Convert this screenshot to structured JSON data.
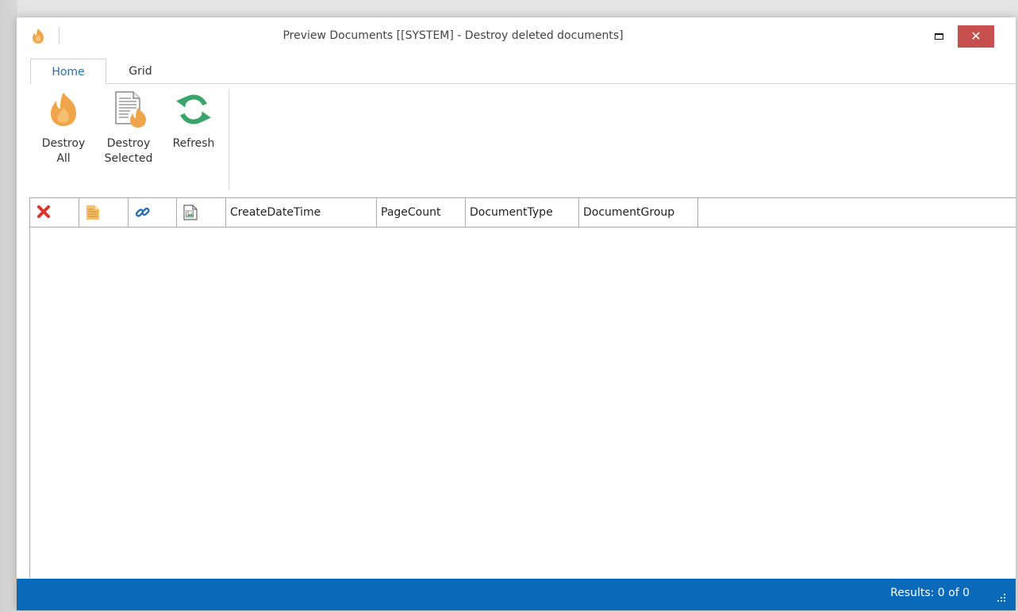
{
  "window": {
    "title": "Preview Documents [[SYSTEM] - Destroy deleted documents]",
    "close_glyph": "✕",
    "app_icon": "flame-icon"
  },
  "tabs": [
    {
      "label": "Home",
      "active": true
    },
    {
      "label": "Grid",
      "active": false
    }
  ],
  "ribbon": {
    "buttons": [
      {
        "label": "Destroy\nAll",
        "icon": "flame-icon"
      },
      {
        "label": "Destroy\nSelected",
        "icon": "document-flame-icon"
      },
      {
        "label": "Refresh",
        "icon": "refresh-icon"
      }
    ]
  },
  "grid": {
    "icon_columns": [
      "delete-icon",
      "document-icon",
      "link-icon",
      "image-document-icon"
    ],
    "columns": [
      "CreateDateTime",
      "PageCount",
      "DocumentType",
      "DocumentGroup"
    ],
    "rows": []
  },
  "status": {
    "results": "Results: 0 of 0"
  },
  "colors": {
    "accent": "#0a69b8",
    "close_button": "#c7504f",
    "flame": "#f0a54a",
    "refresh": "#3aa56a",
    "delete": "#d9362b",
    "link": "#2a6db5"
  }
}
